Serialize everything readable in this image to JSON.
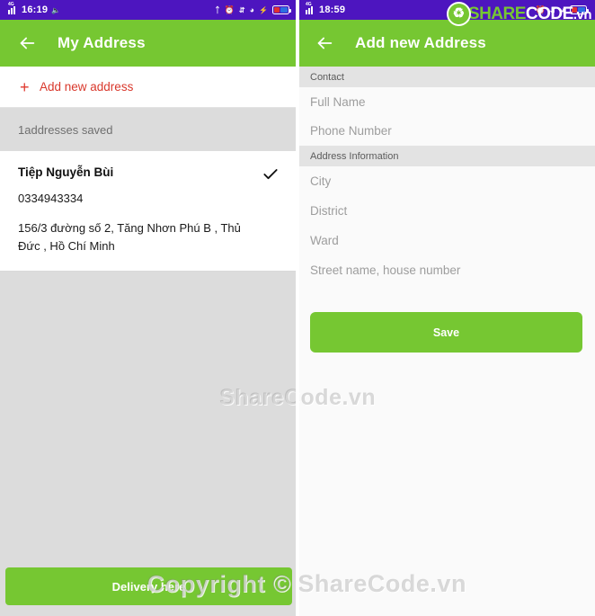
{
  "left": {
    "statusbar": {
      "network": "4G",
      "time": "16:19",
      "mic_icon": "microphone-icon",
      "bluetooth_icon": "bluetooth-icon",
      "alarm_icon": "alarm-icon",
      "data_icon": "data-transfer-icon",
      "wifi_icon": "wifi-icon",
      "charging_icon": "charging-bolt-icon",
      "battery_icon": "battery-icon"
    },
    "appbar": {
      "back_icon": "back-arrow-icon",
      "title": "My Address"
    },
    "add_new": {
      "plus_icon": "plus-icon",
      "label": "Add new address"
    },
    "count_label": "1addresses saved",
    "address": {
      "name": "Tiệp Nguyễn Bùi",
      "phone": "0334943334",
      "detail": "156/3 đường số 2, Tăng Nhơn Phú B , Thủ Đức , Hồ Chí Minh",
      "check_icon": "check-icon"
    },
    "delivery_button": "Delivery here"
  },
  "right": {
    "statusbar": {
      "network": "4G",
      "time": "18:59",
      "alarm_icon": "alarm-icon",
      "data_icon": "data-transfer-icon",
      "wifi_icon": "wifi-icon",
      "battery_icon": "battery-icon"
    },
    "appbar": {
      "back_icon": "back-arrow-icon",
      "title": "Add new Address"
    },
    "sections": [
      {
        "title": "Contact"
      },
      {
        "title": "Address Information"
      }
    ],
    "contact_fields": [
      {
        "placeholder": "Full Name",
        "value": ""
      },
      {
        "placeholder": "Phone Number",
        "value": ""
      }
    ],
    "address_fields": [
      {
        "placeholder": "City",
        "value": ""
      },
      {
        "placeholder": "District",
        "value": ""
      },
      {
        "placeholder": "Ward",
        "value": ""
      },
      {
        "placeholder": "Street name, house number",
        "value": ""
      }
    ],
    "save_button": "Save"
  },
  "watermarks": {
    "center": "ShareCode.vn",
    "bottom": "Copyright © ShareCode.vn",
    "logo": {
      "mark_icon": "sharecode-logo-icon",
      "part1": "SHARE",
      "part2": "CODE",
      "part3": ".vn"
    }
  },
  "colors": {
    "green": "#76c732",
    "purple": "#4d15bf",
    "red": "#d9382c",
    "gray_bar": "#dcdcdc"
  }
}
